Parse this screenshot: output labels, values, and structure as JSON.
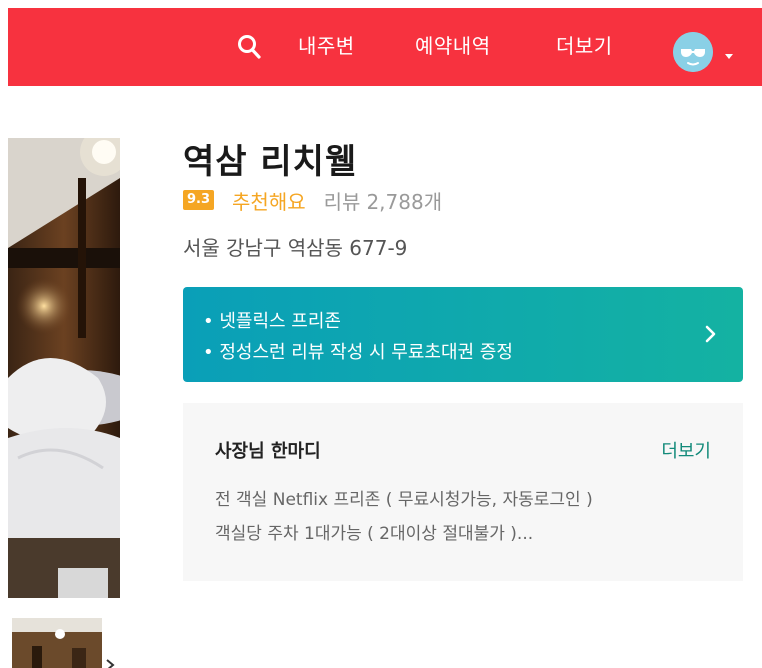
{
  "header": {
    "nav": {
      "nearby": "내주변",
      "bookings": "예약내역",
      "more": "더보기"
    },
    "icons": [
      "search-icon",
      "avatar-icon",
      "caret-down-icon"
    ],
    "brand_color": "#f7323f"
  },
  "hotel": {
    "name": "역삼 리치웰",
    "score": "9.3",
    "rating_text": "추천해요",
    "review_label": "리뷰",
    "review_count": "2,788개",
    "address": "서울 강남구 역삼동 677-9"
  },
  "promo": {
    "line1": "• 넷플릭스 프리존",
    "line2": "• 정성스런 리뷰 작성 시 무료초대권 증정",
    "icon": "chevron-right-icon"
  },
  "owner_note": {
    "title": "사장님 한마디",
    "more": "더보기",
    "text_line1": "전 객실 Netflix 프리존 ( 무료시청가능, 자동로그인 )",
    "text_line2": "객실당 주차 1대가능 ( 2대이상 절대불가 )..."
  },
  "colors": {
    "accent_orange": "#f5a623",
    "promo_teal": "#0a9fb8",
    "link_green": "#128a7a"
  }
}
